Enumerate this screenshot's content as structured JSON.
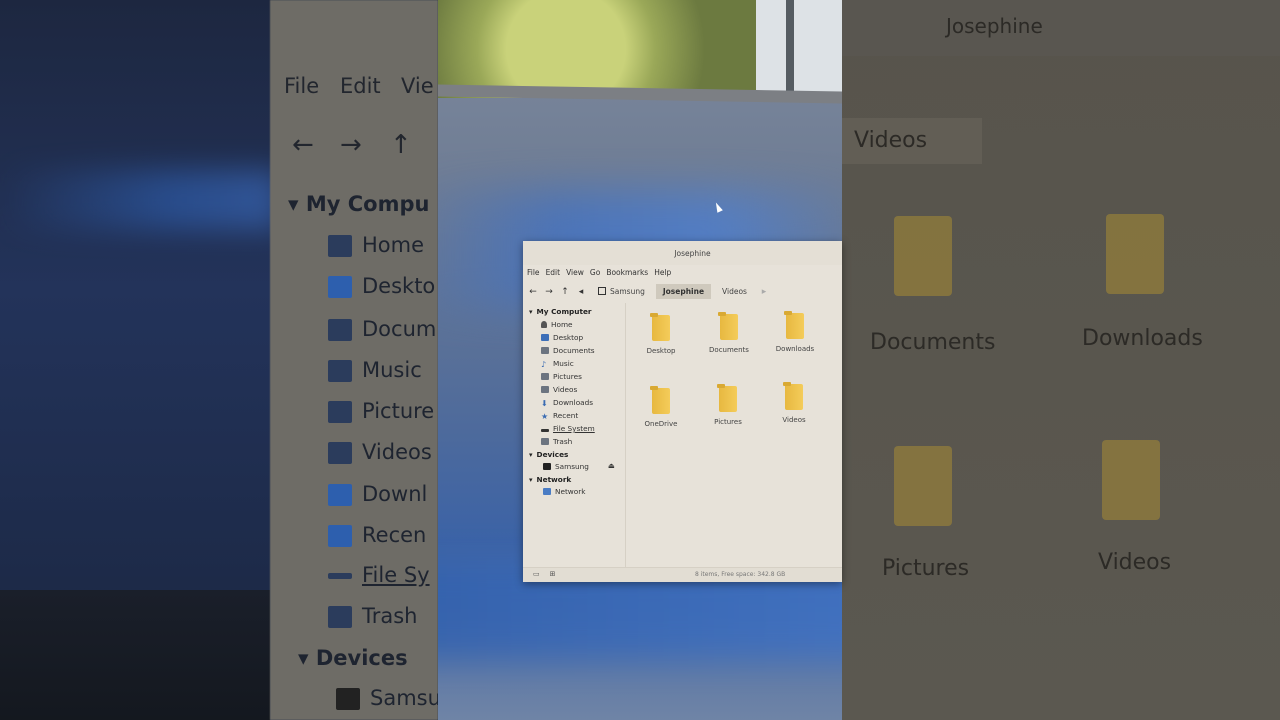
{
  "window": {
    "title": "Josephine",
    "menu": [
      "File",
      "Edit",
      "View",
      "Go",
      "Bookmarks",
      "Help"
    ],
    "breadcrumb": [
      "Samsung",
      "Josephine",
      "Videos"
    ],
    "sidebar": {
      "my_computer_label": "My Computer",
      "places": [
        "Home",
        "Desktop",
        "Documents",
        "Music",
        "Pictures",
        "Videos",
        "Downloads",
        "Recent",
        "File System",
        "Trash"
      ],
      "devices_label": "Devices",
      "devices": [
        "Samsung"
      ],
      "network_label": "Network",
      "network": [
        "Network"
      ]
    },
    "folders": [
      "Desktop",
      "Documents",
      "Downloads",
      "OneDrive",
      "Pictures",
      "Videos"
    ],
    "status": "8 items, Free space: 342.8 GB"
  },
  "backdrop_left": {
    "menu": [
      "File",
      "Edit",
      "Vie"
    ],
    "sidebar_header": "My Compu",
    "items": [
      "Home",
      "Deskto",
      "Docum",
      "Music",
      "Picture",
      "Videos",
      "Downl",
      "Recen",
      "File Sy",
      "Trash"
    ],
    "devices_header": "Devices",
    "device": "Samsu"
  },
  "backdrop_right": {
    "title": "Josephine",
    "crumb": "Videos",
    "folders": [
      "Documents",
      "Downloads",
      "Pictures",
      "Videos"
    ]
  }
}
